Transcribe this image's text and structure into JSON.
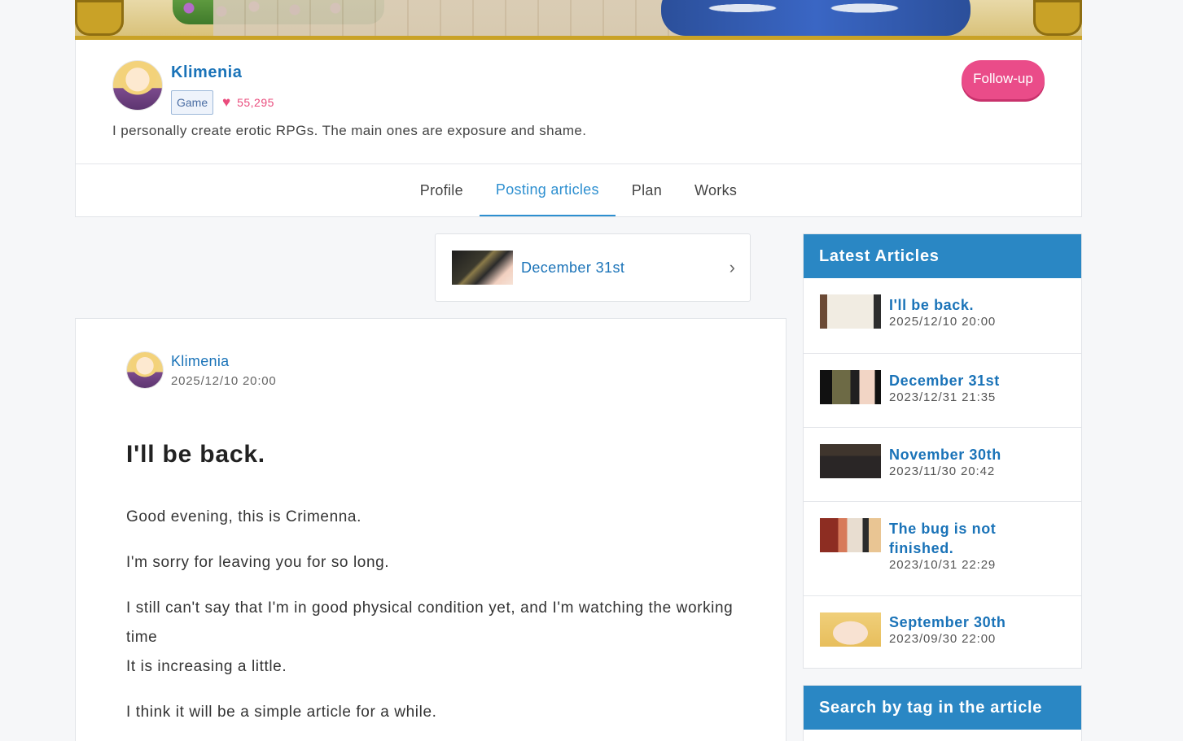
{
  "profile": {
    "name": "Klimenia",
    "category": "Game",
    "likes": "55,295",
    "follow_label": "Follow-up",
    "bio": "I personally create erotic RPGs. The main ones are exposure and shame."
  },
  "tabs": [
    {
      "label": "Profile",
      "active": false
    },
    {
      "label": "Posting articles",
      "active": true
    },
    {
      "label": "Plan",
      "active": false
    },
    {
      "label": "Works",
      "active": false
    }
  ],
  "prev_nav": {
    "label": "December 31st"
  },
  "article": {
    "author": "Klimenia",
    "date": "2025/12/10 20:00",
    "title": "I'll be back.",
    "paragraphs": [
      "Good evening, this is Crimenna.",
      "I'm sorry for leaving you for so long.",
      "I still can't say that I'm in good physical condition yet, and I'm watching the working time",
      "It is increasing a little.",
      "I think it will be a simple article for a while."
    ]
  },
  "sidebar": {
    "latest_heading": "Latest Articles",
    "latest": [
      {
        "title": "I'll be back.",
        "date": "2025/12/10 20:00"
      },
      {
        "title": "December 31st",
        "date": "2023/12/31 21:35"
      },
      {
        "title": "November 30th",
        "date": "2023/11/30 20:42"
      },
      {
        "title": "The bug is not finished.",
        "date": "2023/10/31 22:29"
      },
      {
        "title": "September 30th",
        "date": "2023/09/30 22:00"
      }
    ],
    "tags_heading": "Search by tag in the article"
  },
  "colors": {
    "accent": "#2a87c4",
    "link": "#1a73b8",
    "follow": "#ea4c89",
    "heart": "#ea4c7d"
  },
  "icons": {
    "likes": "heart-icon",
    "prev_nav": "chevron-right-icon"
  }
}
